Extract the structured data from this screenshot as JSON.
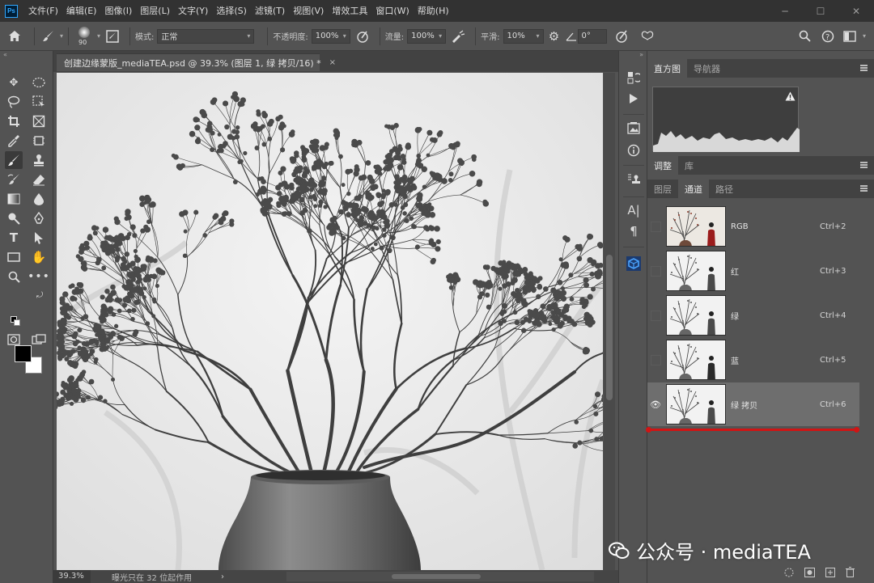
{
  "menu": {
    "logo": "Ps",
    "items": [
      "文件(F)",
      "编辑(E)",
      "图像(I)",
      "图层(L)",
      "文字(Y)",
      "选择(S)",
      "滤镜(T)",
      "视图(V)",
      "增效工具",
      "窗口(W)",
      "帮助(H)"
    ]
  },
  "window_controls": [
    "minimize-icon",
    "restore-icon",
    "close-icon"
  ],
  "options": {
    "brush_size": "90",
    "mode_label": "模式:",
    "mode_value": "正常",
    "opacity_label": "不透明度:",
    "opacity_value": "100%",
    "flow_label": "流量:",
    "flow_value": "100%",
    "smoothing_label": "平滑:",
    "smoothing_value": "10%",
    "angle_value": "0°"
  },
  "document": {
    "tab_title": "创建边缘蒙版_mediaTEA.psd @ 39.3% (图层 1, 绿 拷贝/16) *",
    "close": "×",
    "zoom": "39.3%",
    "status": "曝光只在 32 位起作用",
    "status_arrow": "›"
  },
  "panels": {
    "group1_tabs": [
      "直方图",
      "导航器"
    ],
    "group2_tabs": [
      "调整",
      "库"
    ],
    "group3_tabs": [
      "图层",
      "通道",
      "路径"
    ],
    "channels": [
      {
        "name": "RGB",
        "shortcut": "Ctrl+2",
        "visible": false,
        "selected": false
      },
      {
        "name": "红",
        "shortcut": "Ctrl+3",
        "visible": false,
        "selected": false
      },
      {
        "name": "绿",
        "shortcut": "Ctrl+4",
        "visible": false,
        "selected": false
      },
      {
        "name": "蓝",
        "shortcut": "Ctrl+5",
        "visible": false,
        "selected": false
      },
      {
        "name": "绿 拷贝",
        "shortcut": "Ctrl+6",
        "visible": true,
        "selected": true
      }
    ]
  },
  "watermark": "公众号 · mediaTEA",
  "colors": {
    "accent_red": "#d11414",
    "foreground": "#000000",
    "background": "#ffffff",
    "ps_blue": "#31a8ff"
  }
}
